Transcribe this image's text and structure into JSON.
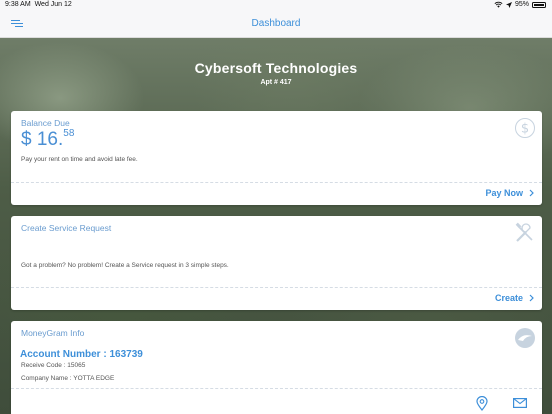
{
  "status_bar": {
    "time": "9:38 AM",
    "date": "Wed Jun 12",
    "battery": "95%"
  },
  "nav": {
    "title": "Dashboard"
  },
  "header": {
    "company": "Cybersoft Technologies",
    "apartment": "Apt # 417"
  },
  "balance": {
    "title": "Balance Due",
    "currency": "$",
    "amount_whole": "16.",
    "amount_cents": "58",
    "message": "Pay your rent on time and avoid late fee.",
    "action": "Pay Now"
  },
  "service": {
    "title": "Create Service Request",
    "message": "Got a problem? No problem! Create a Service request in 3 simple steps.",
    "action": "Create"
  },
  "moneygram": {
    "title": "MoneyGram Info",
    "account": "Account Number : 163739",
    "receive_code": "Receive Code : 15065",
    "company_name": "Company Name : YOTTA EDGE"
  },
  "colors": {
    "accent": "#3d8fd9",
    "title_blue": "#6a9ccf",
    "icon_gray": "#c7d3df"
  },
  "icons": [
    "menu-icon",
    "wifi-icon",
    "location-arrow-icon",
    "battery-icon",
    "dollar-icon",
    "tools-icon",
    "moneygram-icon",
    "map-pin-icon",
    "mail-icon",
    "chevron-right-icon"
  ]
}
